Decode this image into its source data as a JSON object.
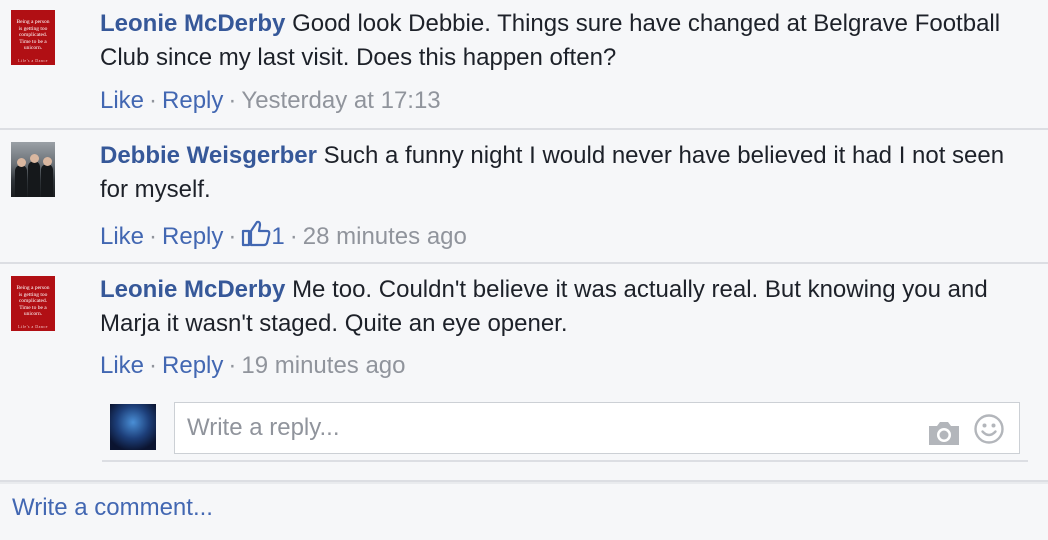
{
  "comments": [
    {
      "author": "Leonie McDerby",
      "text": "Good look Debbie. Things sure have changed at Belgrave Football Club since my last visit. Does this happen often?",
      "like_label": "Like",
      "reply_label": "Reply",
      "timestamp": "Yesterday at 17:13",
      "avatar_lines": [
        "Being a person",
        "is getting too",
        "complicated.",
        "Time to be a unicorn."
      ],
      "avatar_footer": "Life's a Dance"
    },
    {
      "author": "Debbie Weisgerber",
      "text": "Such a funny night I would never have believed it had I not seen for myself.",
      "like_label": "Like",
      "reply_label": "Reply",
      "like_count": "1",
      "timestamp": "28 minutes ago"
    },
    {
      "author": "Leonie McDerby",
      "text": "Me too. Couldn't believe it was actually real. But knowing you and Marja it wasn't staged. Quite an eye opener.",
      "like_label": "Like",
      "reply_label": "Reply",
      "timestamp": "19 minutes ago",
      "avatar_lines": [
        "Being a person",
        "is getting too",
        "complicated.",
        "Time to be a unicorn."
      ],
      "avatar_footer": "Life's a Dance"
    }
  ],
  "reply_box": {
    "placeholder": "Write a reply..."
  },
  "write_comment": {
    "label": "Write a comment..."
  },
  "colors": {
    "link": "#4267b2",
    "author": "#365899",
    "meta": "#90949c",
    "avatar_red": "#b10f14"
  },
  "icons": [
    "like-thumb-icon",
    "camera-icon",
    "smiley-icon"
  ]
}
